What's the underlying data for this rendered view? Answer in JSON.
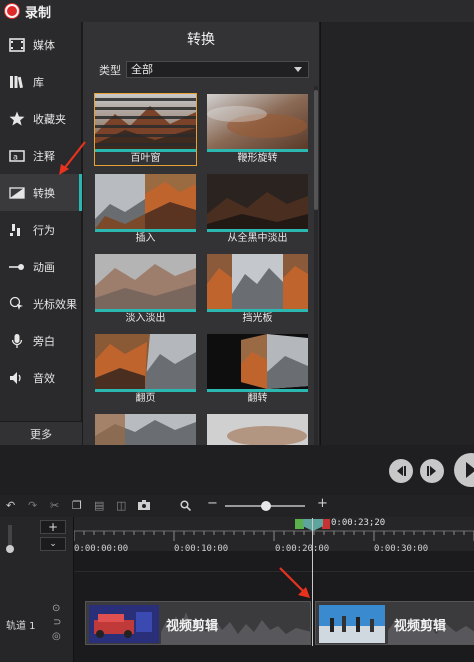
{
  "app": {
    "record_label": "录制"
  },
  "sidebar": {
    "items": [
      {
        "label": "媒体",
        "icon": "film-icon"
      },
      {
        "label": "库",
        "icon": "library-icon"
      },
      {
        "label": "收藏夹",
        "icon": "star-icon"
      },
      {
        "label": "注释",
        "icon": "annotation-icon"
      },
      {
        "label": "转换",
        "icon": "transition-icon",
        "active": true
      },
      {
        "label": "行为",
        "icon": "behavior-icon"
      },
      {
        "label": "动画",
        "icon": "animation-icon"
      },
      {
        "label": "光标效果",
        "icon": "cursor-effect-icon"
      },
      {
        "label": "旁白",
        "icon": "microphone-icon"
      },
      {
        "label": "音效",
        "icon": "audio-icon"
      }
    ],
    "more_label": "更多"
  },
  "panel": {
    "title": "转换",
    "filter_label": "类型",
    "filter_value": "全部",
    "transitions": [
      {
        "label": "百叶窗",
        "selected": true
      },
      {
        "label": "鞭形旋转"
      },
      {
        "label": "插入"
      },
      {
        "label": "从全黑中淡出"
      },
      {
        "label": "淡入淡出"
      },
      {
        "label": "挡光板"
      },
      {
        "label": "翻页"
      },
      {
        "label": "翻转"
      },
      {
        "label": ""
      },
      {
        "label": ""
      }
    ]
  },
  "timeline": {
    "playhead_time": "0:00:23;20",
    "ruler": [
      "0:00:00;00",
      "0:00:10;00",
      "0:00:20;00",
      "0:00:30;00"
    ],
    "track_label": "轨道 1",
    "clips": [
      {
        "name": "视频剪辑"
      },
      {
        "name": "视频剪辑"
      }
    ]
  },
  "colors": {
    "accent": "#2bb8b0",
    "record": "#e02a2a",
    "selected_outline": "#e8a233",
    "annotation_arrow": "#e8321e"
  }
}
